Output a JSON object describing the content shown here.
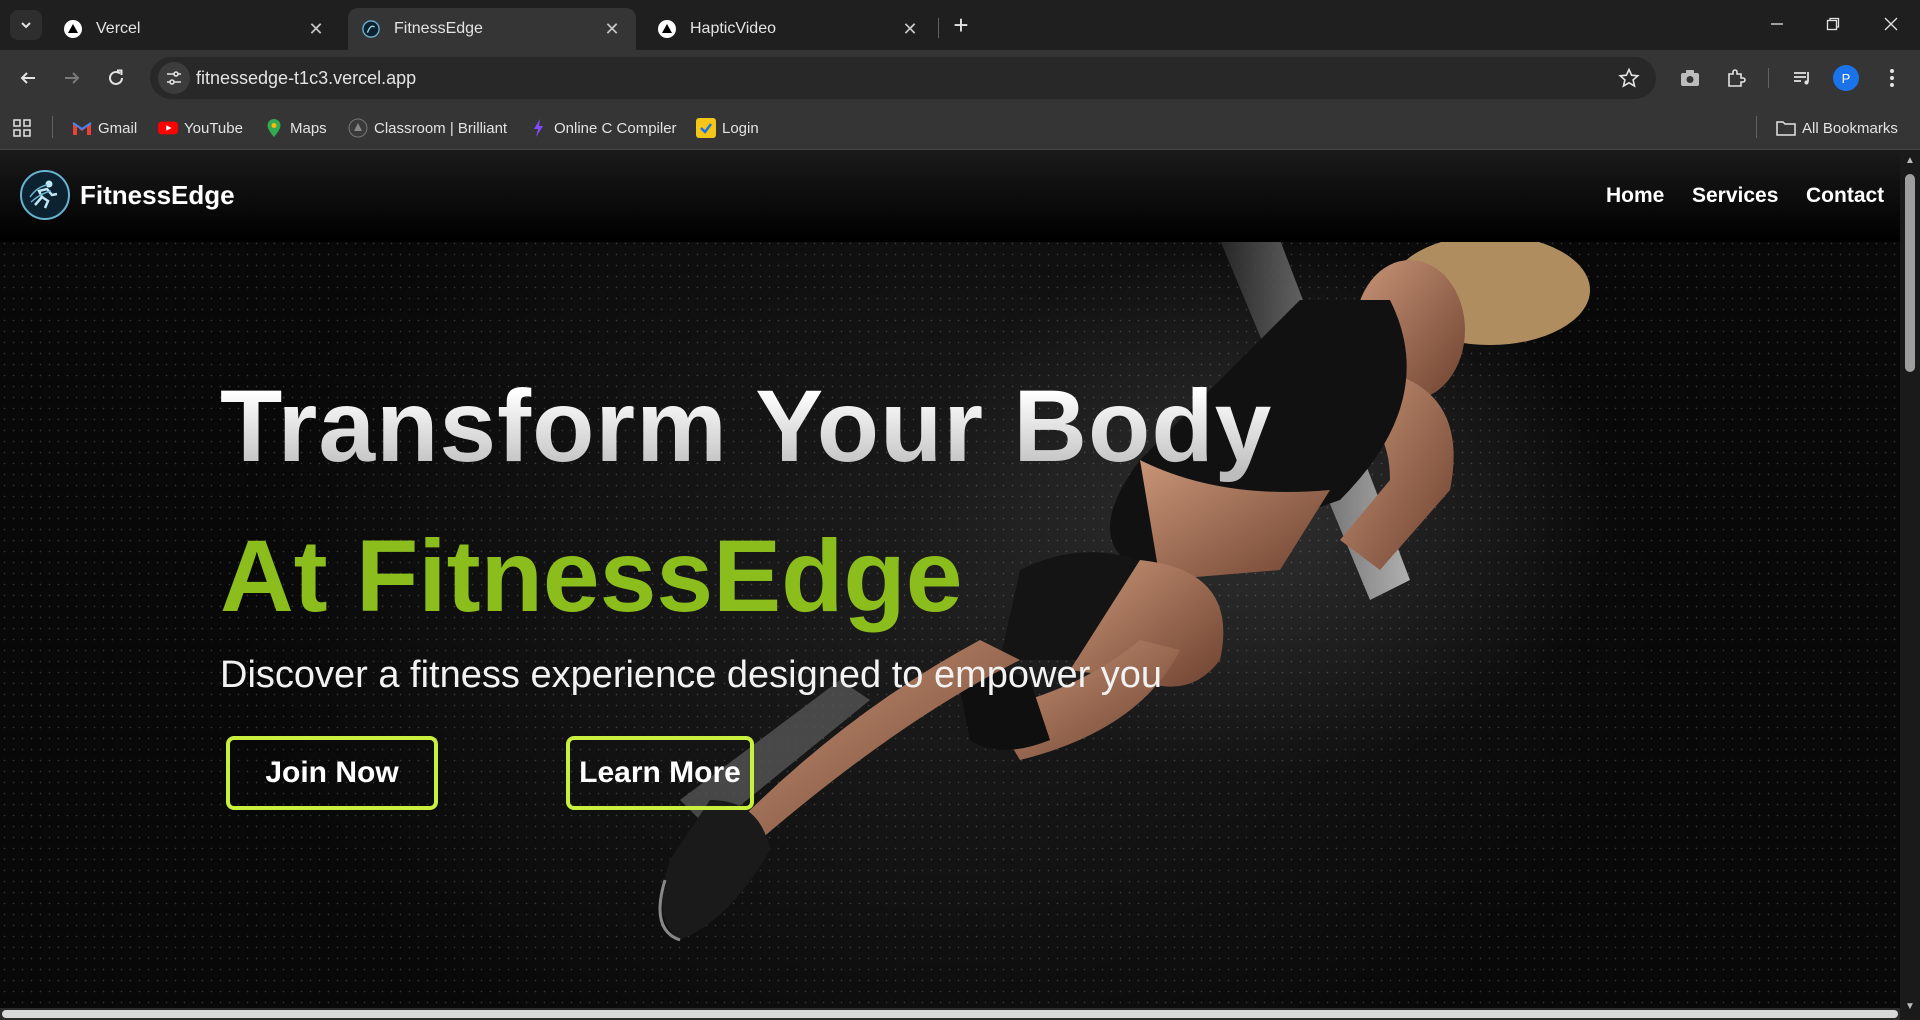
{
  "browser": {
    "tabs": [
      {
        "title": "Vercel",
        "icon": "vercel-triangle-icon",
        "active": false
      },
      {
        "title": "FitnessEdge",
        "icon": "fitnessedge-favicon",
        "active": true
      },
      {
        "title": "HapticVideo",
        "icon": "vercel-triangle-icon",
        "active": false
      }
    ],
    "url": "fitnessedge-t1c3.vercel.app",
    "bookmarks": [
      {
        "label": "Gmail",
        "icon": "gmail-icon"
      },
      {
        "label": "YouTube",
        "icon": "youtube-icon"
      },
      {
        "label": "Maps",
        "icon": "maps-icon"
      },
      {
        "label": "Classroom | Brilliant",
        "icon": "brilliant-icon"
      },
      {
        "label": "Online C Compiler",
        "icon": "compiler-icon"
      },
      {
        "label": "Login",
        "icon": "login-icon"
      }
    ],
    "all_bookmarks": "All Bookmarks",
    "profile_initial": "P",
    "accent": "#1a73e8"
  },
  "site": {
    "brand": "FitnessEdge",
    "nav": [
      "Home",
      "Services",
      "Contact"
    ],
    "hero": {
      "title": "Transform Your Body",
      "subtitle": "At FitnessEdge",
      "description": "Discover a fitness experience designed to empower you",
      "primary_cta": "Join Now",
      "secondary_cta": "Learn More"
    },
    "colors": {
      "accent_green": "#8bbd1c",
      "button_border": "#c8f03c",
      "background": "#0b0b0b"
    }
  }
}
